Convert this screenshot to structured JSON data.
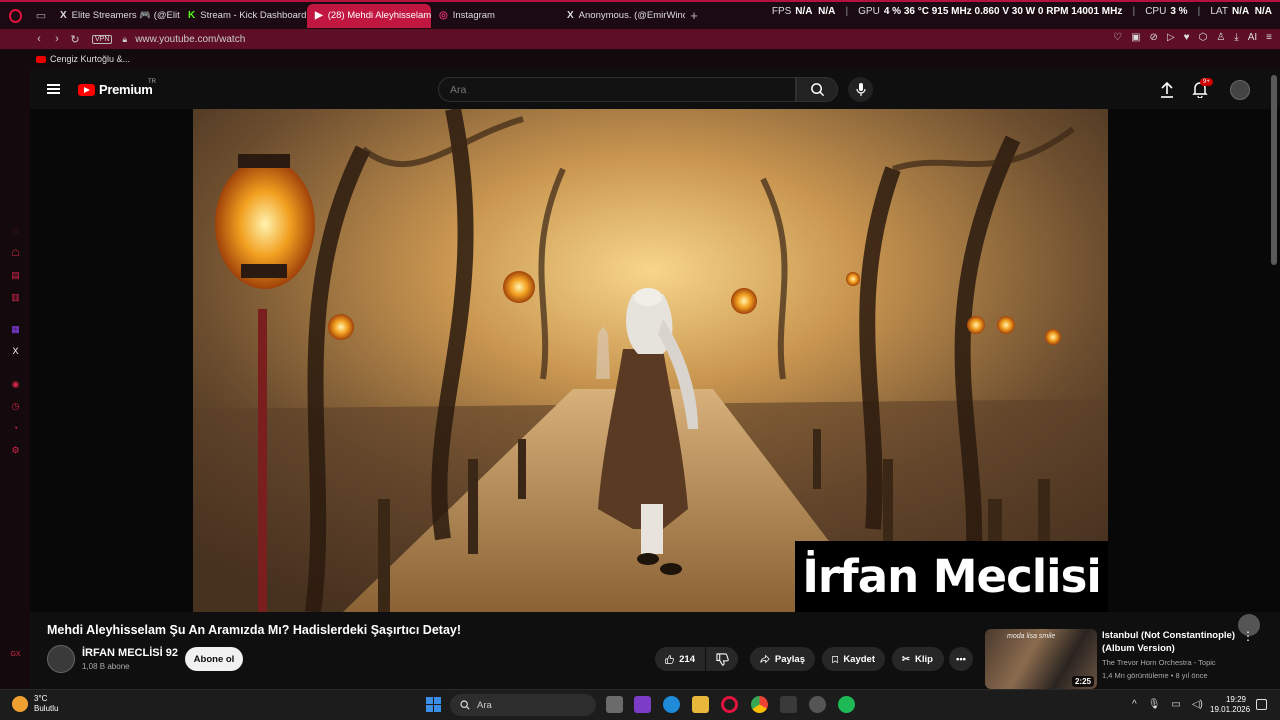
{
  "browser": {
    "tabs": [
      {
        "label": "Elite Streamers 🎮 (@Elite",
        "favicon": "X",
        "active": false
      },
      {
        "label": "Stream - Kick Dashboard",
        "favicon": "K",
        "active": false
      },
      {
        "label": "(28) Mehdi Aleyhisselam",
        "favicon": "▶",
        "active": true
      },
      {
        "label": "Instagram",
        "favicon": "◎",
        "active": false
      },
      {
        "label": "Anonymous. (@EmirWinch",
        "favicon": "X",
        "active": false
      }
    ],
    "stats": {
      "fps_label": "FPS",
      "fps_value": "N/A",
      "fps_value2": "N/A",
      "gpu_label": "GPU",
      "gpu_values": "4 %  36 °C  915 MHz  0.860 V  30 W  0 RPM  14001 MHz",
      "cpu_label": "CPU",
      "cpu_value": "3 %",
      "lat_label": "LAT",
      "lat_value": "N/A",
      "lat_value2": "N/A"
    },
    "vpn_label": "VPN",
    "url": "www.youtube.com/watch",
    "ai_label": "AI",
    "bookmarks": [
      {
        "label": "Cengiz Kurtoğlu &..."
      }
    ]
  },
  "youtube": {
    "logo_text": "Premium",
    "logo_region": "TR",
    "search_placeholder": "Ara",
    "notification_badge": "9+",
    "video_overlay_text": "İrfan Meclisi",
    "video_title": "Mehdi Aleyhisselam Şu An Aramızda Mı? Hadislerdeki Şaşırtıcı Detay!",
    "channel_name": "İRFAN MECLİSİ 92",
    "channel_subs": "1,08 B abone",
    "subscribe_label": "Abone ol",
    "like_count": "214",
    "share_label": "Paylaş",
    "save_label": "Kaydet",
    "clip_label": "Klip",
    "recommended": {
      "thumb_text": "moda lisa smile",
      "duration": "2:25",
      "title": "Istanbul (Not Constantinople) (Album Version)",
      "channel": "The Trevor Horn Orchestra - Topic",
      "meta": "1,4 Mn görüntüleme • 8 yıl önce"
    }
  },
  "taskbar": {
    "weather_temp": "3°C",
    "weather_desc": "Bulutlu",
    "search_label": "Ara",
    "time": "19:29",
    "date": "19.01.2026"
  }
}
